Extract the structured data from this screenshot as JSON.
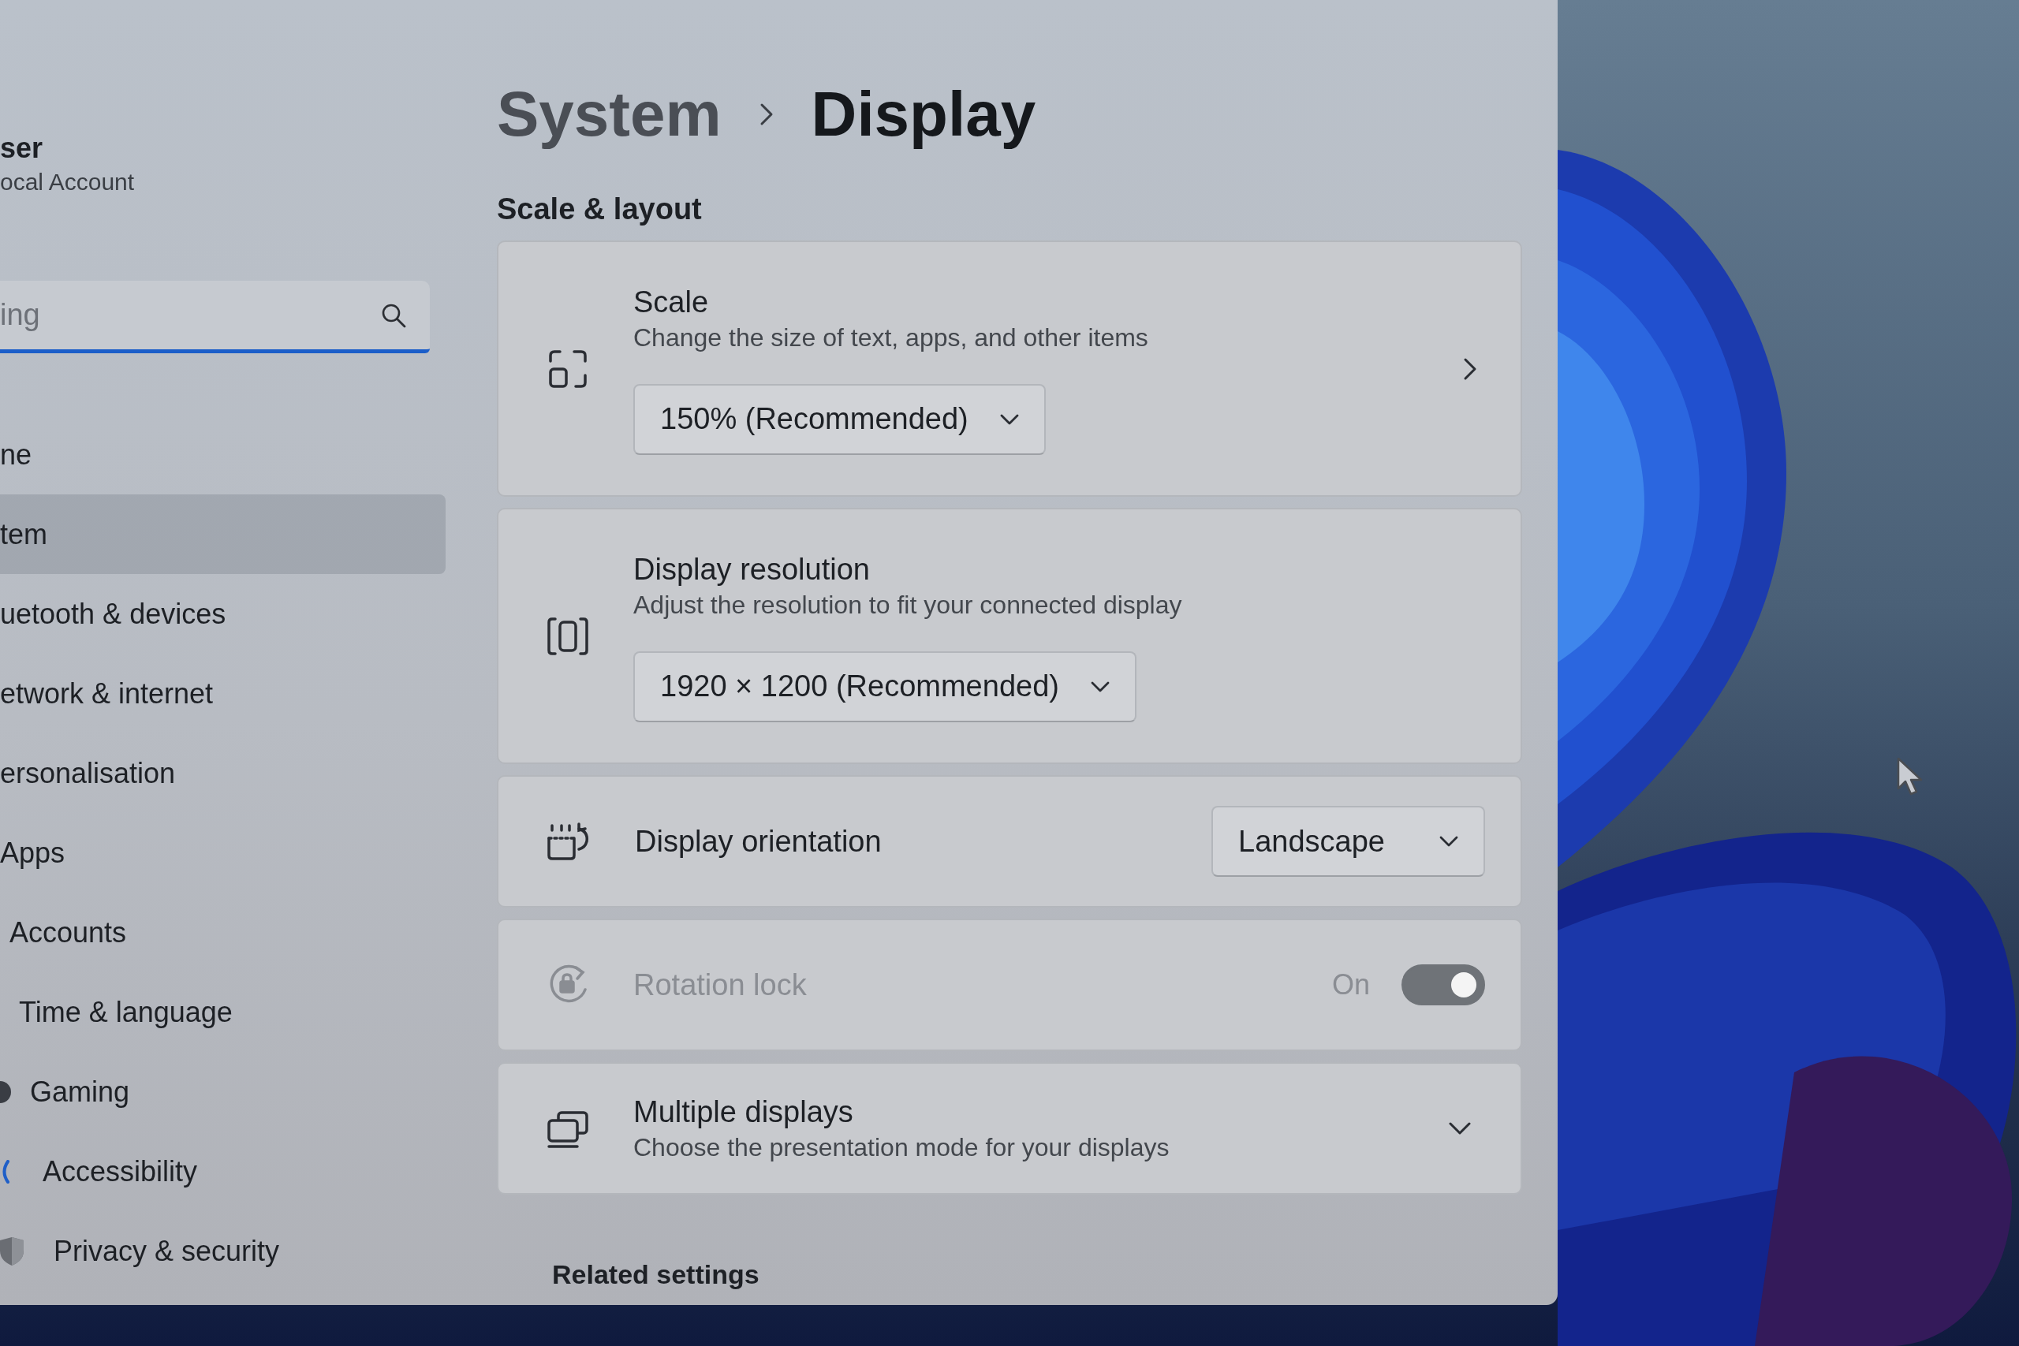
{
  "sidebar": {
    "user": {
      "name": "ser",
      "account": "ocal Account"
    },
    "search": {
      "placeholder": "ing"
    },
    "items": [
      {
        "label": "ne",
        "selected": false
      },
      {
        "label": "tem",
        "selected": true
      },
      {
        "label": "uetooth & devices",
        "selected": false
      },
      {
        "label": "etwork & internet",
        "selected": false
      },
      {
        "label": "ersonalisation",
        "selected": false
      },
      {
        "label": "Apps",
        "selected": false
      },
      {
        "label": "Accounts",
        "selected": false
      },
      {
        "label": "Time & language",
        "selected": false
      },
      {
        "label": "Gaming",
        "selected": false
      },
      {
        "label": "Accessibility",
        "selected": false
      },
      {
        "label": "Privacy & security",
        "selected": false
      }
    ]
  },
  "breadcrumb": [
    {
      "label": "System",
      "current": false
    },
    {
      "label": "Display",
      "current": true
    }
  ],
  "section": {
    "title": "Scale & layout",
    "settings": [
      {
        "kind": "stacked_dropdown",
        "title": "Scale",
        "description": "Change the size of text, apps, and other items",
        "value": "150% (Recommended)",
        "navigable": true,
        "disabled": false
      },
      {
        "kind": "stacked_dropdown",
        "title": "Display resolution",
        "description": "Adjust the resolution to fit your connected display",
        "value": "1920 × 1200 (Recommended)",
        "navigable": false,
        "disabled": false
      },
      {
        "kind": "inline_dropdown",
        "title": "Display orientation",
        "value": "Landscape",
        "navigable": false,
        "disabled": false
      },
      {
        "kind": "toggle",
        "title": "Rotation lock",
        "state_label": "On",
        "on": true,
        "navigable": false,
        "disabled": true
      },
      {
        "kind": "expander",
        "title": "Multiple displays",
        "description": "Choose the presentation mode for your displays",
        "expanded": false,
        "navigable": false,
        "disabled": false
      }
    ]
  },
  "related": {
    "title": "Related settings"
  }
}
